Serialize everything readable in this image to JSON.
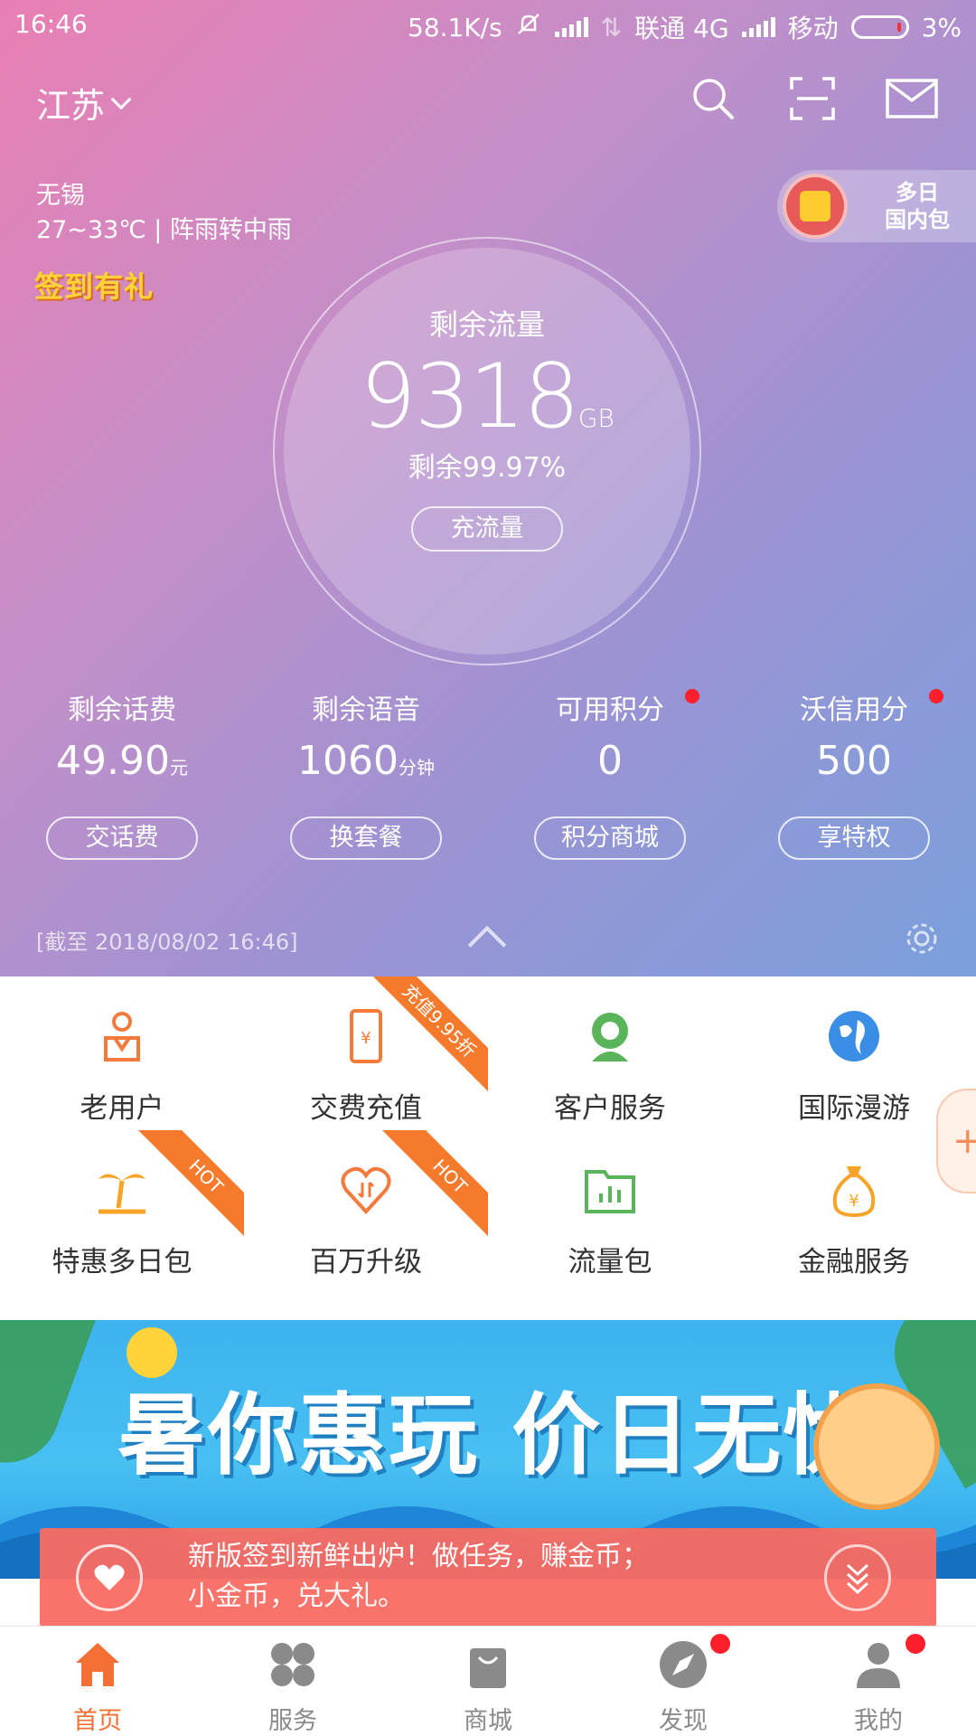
{
  "status_bar": {
    "time": "16:46",
    "speed": "58.1K/s",
    "carrier1": "联通 4G",
    "carrier2": "移动",
    "battery": "3%"
  },
  "header": {
    "province": "江苏",
    "icons": [
      "search-icon",
      "scan-icon",
      "mail-icon"
    ]
  },
  "weather": {
    "city": "无锡",
    "forecast": "27~33℃ | 阵雨转中雨"
  },
  "checkin_label": "签到有礼",
  "package_badge": {
    "line1": "多日",
    "line2": "国内包"
  },
  "data_circle": {
    "label": "剩余流量",
    "value": "9318",
    "unit": "GB",
    "percent": "剩余99.97%",
    "button": "充流量"
  },
  "stats": [
    {
      "title": "剩余话费",
      "value": "49.90",
      "unit": "元",
      "action": "交话费",
      "dot": false
    },
    {
      "title": "剩余语音",
      "value": "1060",
      "unit": "分钟",
      "action": "换套餐",
      "dot": false
    },
    {
      "title": "可用积分",
      "value": "0",
      "unit": "",
      "action": "积分商城",
      "dot": true
    },
    {
      "title": "沃信用分",
      "value": "500",
      "unit": "",
      "action": "享特权",
      "dot": true
    }
  ],
  "as_of": "[截至 2018/08/02 16:46]",
  "services": [
    {
      "label": "老用户",
      "icon": "old-user-icon",
      "ribbon": ""
    },
    {
      "label": "交费充值",
      "icon": "phone-recharge-icon",
      "ribbon": "充值9.95折"
    },
    {
      "label": "客户服务",
      "icon": "customer-service-icon",
      "ribbon": ""
    },
    {
      "label": "国际漫游",
      "icon": "globe-icon",
      "ribbon": ""
    },
    {
      "label": "特惠多日包",
      "icon": "palm-tree-icon",
      "ribbon": "HOT"
    },
    {
      "label": "百万升级",
      "icon": "heart-upgrade-icon",
      "ribbon": "HOT"
    },
    {
      "label": "流量包",
      "icon": "folder-chart-icon",
      "ribbon": ""
    },
    {
      "label": "金融服务",
      "icon": "money-bag-icon",
      "ribbon": ""
    }
  ],
  "banner": {
    "headline": "暑你惠玩 价日无忧"
  },
  "notice": {
    "line1": "新版签到新鲜出炉！做任务，赚金币；",
    "line2": "小金币，兑大礼。"
  },
  "tabs": [
    {
      "label": "首页",
      "icon": "home-icon",
      "active": true,
      "dot": false
    },
    {
      "label": "服务",
      "icon": "grid-icon",
      "active": false,
      "dot": false
    },
    {
      "label": "商城",
      "icon": "shopping-bag-icon",
      "active": false,
      "dot": false
    },
    {
      "label": "发现",
      "icon": "compass-icon",
      "active": false,
      "dot": true
    },
    {
      "label": "我的",
      "icon": "profile-icon",
      "active": false,
      "dot": true
    }
  ],
  "colors": {
    "accent": "#f46f34",
    "hero_start": "#e97fb3",
    "hero_end": "#7aa0dc",
    "notice_bg": "#fa6c62",
    "badge_dot": "#ff1f2a"
  }
}
